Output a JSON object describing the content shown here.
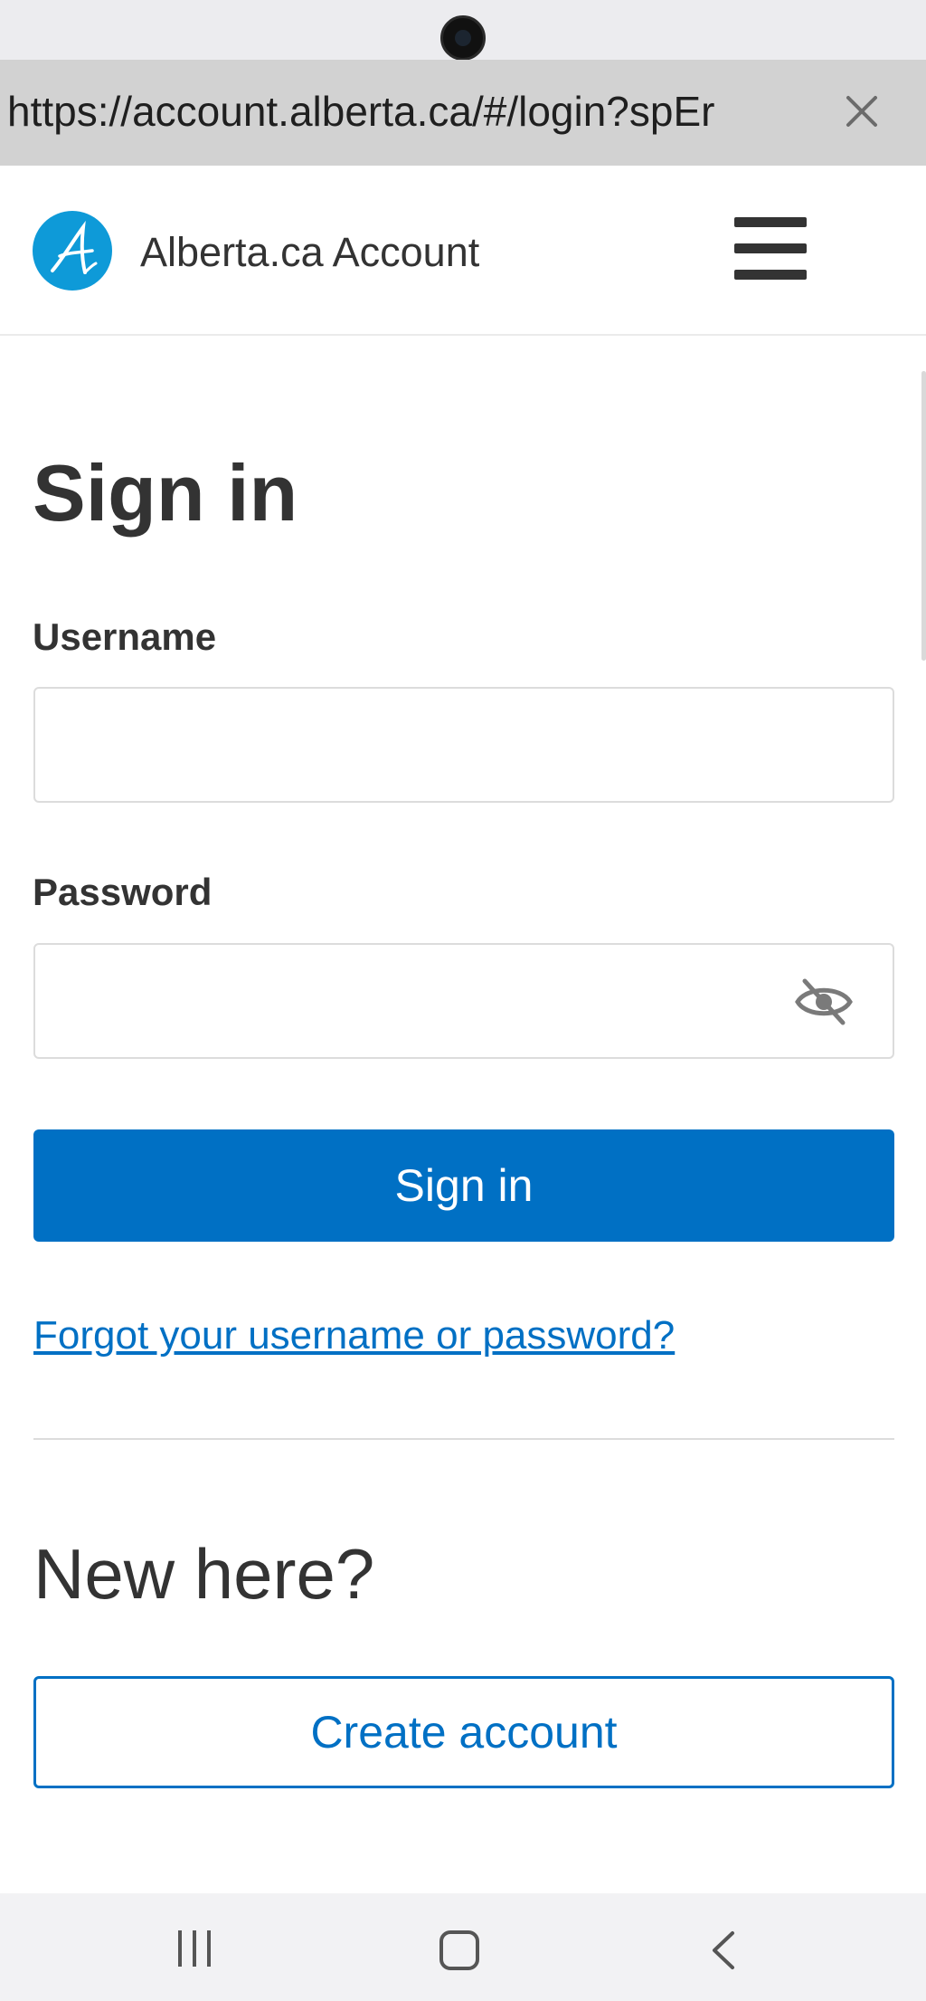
{
  "browser": {
    "url": "https://account.alberta.ca/#/login?spEr",
    "close_icon": "close-icon"
  },
  "header": {
    "logo_icon": "alberta-logo-icon",
    "brand_name": "Alberta.ca Account",
    "menu_icon": "hamburger-menu-icon"
  },
  "form": {
    "title": "Sign in",
    "username_label": "Username",
    "username_value": "",
    "password_label": "Password",
    "password_value": "",
    "password_visibility_icon": "eye-off-icon",
    "submit_label": "Sign in",
    "forgot_link": "Forgot your username or password?"
  },
  "signup": {
    "heading": "New here?",
    "create_label": "Create account"
  },
  "system_nav": {
    "recent_icon": "recent-apps-icon",
    "home_icon": "home-icon",
    "back_icon": "back-icon"
  },
  "colors": {
    "primary": "#0070c4",
    "text": "#333333",
    "url_bar": "#d2d2d2",
    "logo_blue": "#0e9ad8"
  }
}
